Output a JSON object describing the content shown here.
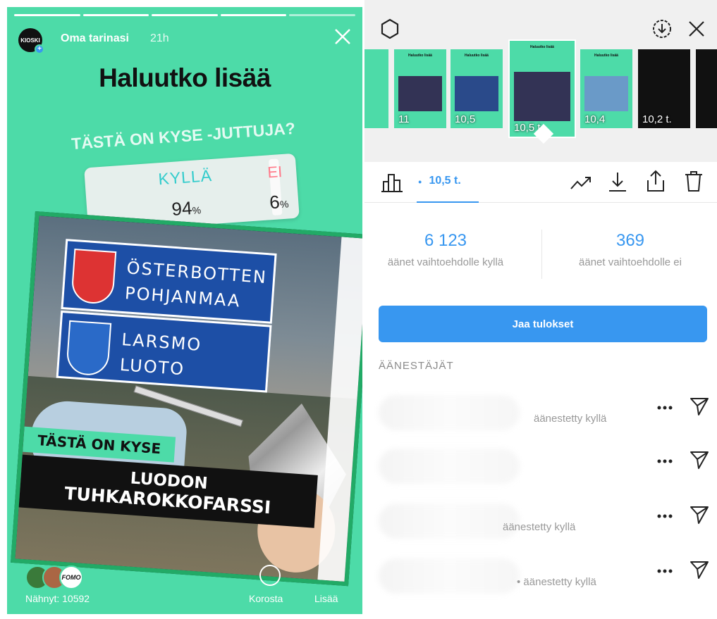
{
  "story": {
    "account_avatar_text": "KIOSKI",
    "username": "Oma tarinasi",
    "time_ago": "21h",
    "title": "Haluutko lisää",
    "question": "TÄSTÄ ON KYSE -JUTTUJA?",
    "poll": {
      "yes_label": "KYLLÄ",
      "yes_percent": "94",
      "no_label": "EI",
      "no_percent": "6",
      "percent_sign": "%"
    },
    "shared_post": {
      "sign1_line1": "ÖSTERBOTTEN",
      "sign1_line2": "POHJANMAA",
      "sign2_line1": "LARSMO",
      "sign2_line2": "LUOTO",
      "banner_label": "TÄSTÄ ON KYSE",
      "headline_line1": "LUODON",
      "headline_line2": "TUHKAROKKOFARSSI"
    },
    "viewer_badge_text": "FOMO",
    "seen_by": "Nähnyt: 10592",
    "highlight_label": "Korosta",
    "more_label": "Lisää"
  },
  "insights": {
    "thumbnails": [
      {
        "title": "",
        "views": "?"
      },
      {
        "title": "Haluutko lisää",
        "views": "11"
      },
      {
        "title": "Haluutko lisää",
        "views": "10,5"
      },
      {
        "title": "Haluutko lisää",
        "views": "10,5 t."
      },
      {
        "title": "Haluutko lisää",
        "views": "10,4"
      },
      {
        "title": "",
        "views": "10,2 t."
      }
    ],
    "views_tab": "10,5 t.",
    "yes_votes": "6 123",
    "yes_votes_label": "äänet vaihtoehdolle kyllä",
    "no_votes": "369",
    "no_votes_label": "äänet vaihtoehdolle ei",
    "share_button": "Jaa tulokset",
    "voters_heading": "ÄÄNESTÄJÄT",
    "voters": [
      {
        "status": "äänestetty kyllä"
      },
      {
        "status": ""
      },
      {
        "status": "äänestetty kyllä"
      },
      {
        "status": "• äänestetty kyllä"
      }
    ]
  },
  "colors": {
    "story_bg": "#4ddba8",
    "accent_blue": "#3897f0",
    "yes_color": "#33cccc",
    "no_color": "#ff7a8a"
  }
}
